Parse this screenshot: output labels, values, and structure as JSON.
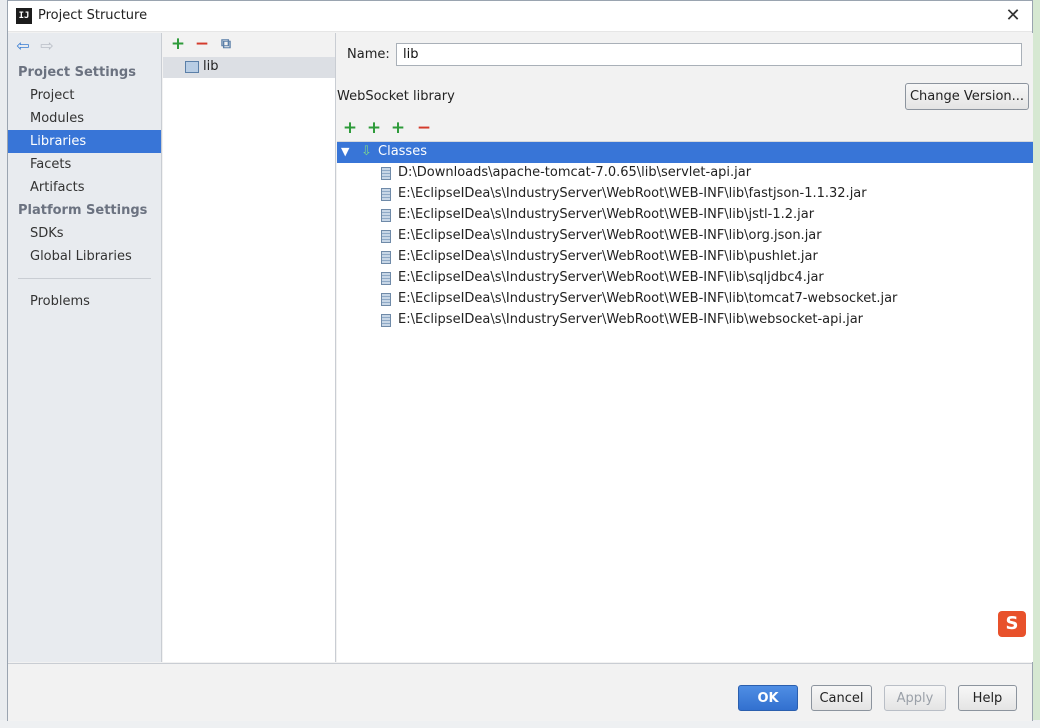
{
  "window": {
    "title": "Project Structure",
    "close_glyph": "✕"
  },
  "nav": {
    "back_glyph": "⇦",
    "forward_glyph": "⇨",
    "project_settings_header": "Project Settings",
    "project_settings_items": [
      "Project",
      "Modules",
      "Libraries",
      "Facets",
      "Artifacts"
    ],
    "platform_settings_header": "Platform Settings",
    "platform_settings_items": [
      "SDKs",
      "Global Libraries"
    ],
    "other_items": [
      "Problems"
    ],
    "selected": "Libraries"
  },
  "libraries": {
    "add_glyph": "+",
    "remove_glyph": "−",
    "copy_glyph": "⧉",
    "items": [
      "lib"
    ]
  },
  "detail": {
    "name_label": "Name:",
    "name_value": "lib",
    "library_type": "WebSocket library",
    "change_version_label": "Change Version...",
    "toolbar": {
      "add_glyph": "+",
      "remove_glyph": "−"
    },
    "classes_label": "Classes",
    "classes_arrow": "▼",
    "classes_icon": "⇩",
    "jars": [
      "D:\\Downloads\\apache-tomcat-7.0.65\\lib\\servlet-api.jar",
      "E:\\EclipseIDea\\s\\IndustryServer\\WebRoot\\WEB-INF\\lib\\fastjson-1.1.32.jar",
      "E:\\EclipseIDea\\s\\IndustryServer\\WebRoot\\WEB-INF\\lib\\jstl-1.2.jar",
      "E:\\EclipseIDea\\s\\IndustryServer\\WebRoot\\WEB-INF\\lib\\org.json.jar",
      "E:\\EclipseIDea\\s\\IndustryServer\\WebRoot\\WEB-INF\\lib\\pushlet.jar",
      "E:\\EclipseIDea\\s\\IndustryServer\\WebRoot\\WEB-INF\\lib\\sqljdbc4.jar",
      "E:\\EclipseIDea\\s\\IndustryServer\\WebRoot\\WEB-INF\\lib\\tomcat7-websocket.jar",
      "E:\\EclipseIDea\\s\\IndustryServer\\WebRoot\\WEB-INF\\lib\\websocket-api.jar"
    ]
  },
  "footer": {
    "ok": "OK",
    "cancel": "Cancel",
    "apply": "Apply",
    "help": "Help"
  },
  "ime": {
    "label": "S"
  },
  "colors": {
    "selection": "#3875d7",
    "add": "#2e9b3a",
    "remove": "#d43b2c"
  }
}
